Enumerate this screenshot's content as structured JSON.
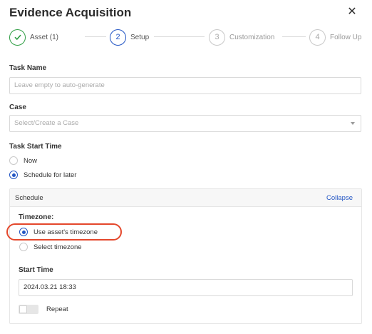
{
  "dialog": {
    "title": "Evidence Acquisition",
    "close_icon": "close-icon"
  },
  "steps": [
    {
      "number": "1",
      "label": "Asset (1)",
      "state": "done"
    },
    {
      "number": "2",
      "label": "Setup",
      "state": "active"
    },
    {
      "number": "3",
      "label": "Customization",
      "state": "pending"
    },
    {
      "number": "4",
      "label": "Follow Up",
      "state": "pending"
    }
  ],
  "task_name": {
    "label": "Task Name",
    "placeholder": "Leave empty to auto-generate",
    "value": ""
  },
  "case": {
    "label": "Case",
    "placeholder": "Select/Create a Case"
  },
  "task_start": {
    "label": "Task Start Time",
    "options": [
      {
        "label": "Now",
        "checked": false
      },
      {
        "label": "Schedule for later",
        "checked": true
      }
    ]
  },
  "schedule": {
    "title": "Schedule",
    "collapse_label": "Collapse",
    "timezone_label": "Timezone:",
    "timezone_options": [
      {
        "label": "Use asset's timezone",
        "checked": true
      },
      {
        "label": "Select timezone",
        "checked": false
      }
    ],
    "start_time_label": "Start Time",
    "start_time_value": "2024.03.21 18:33",
    "repeat_label": "Repeat",
    "repeat_on": false
  },
  "colors": {
    "accent": "#2255c4",
    "success": "#2f9e44",
    "highlight": "#e4472b"
  }
}
